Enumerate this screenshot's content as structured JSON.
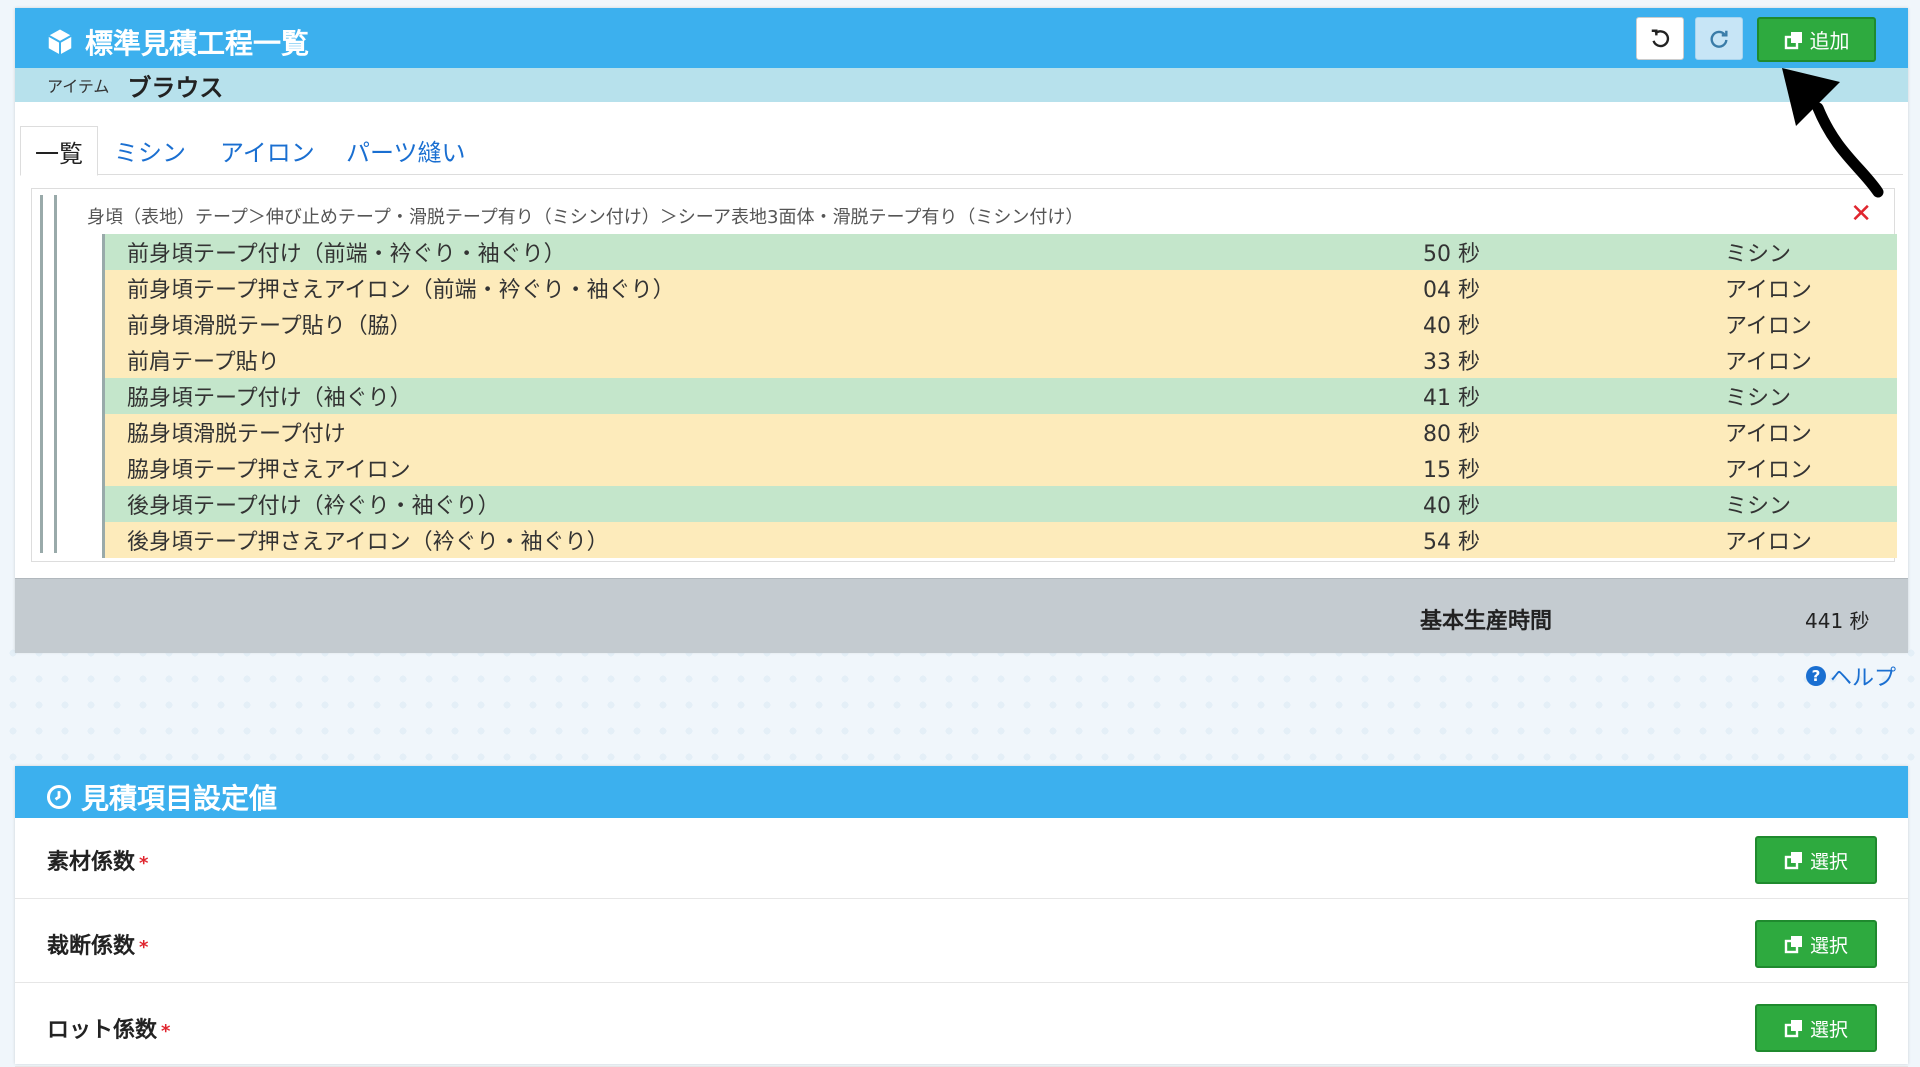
{
  "panel1": {
    "title": "標準見積工程一覧",
    "add_label": "追加",
    "item_label": "アイテム",
    "item_value": "ブラウス",
    "tabs": [
      "一覧",
      "ミシン",
      "アイロン",
      "パーツ縫い"
    ],
    "breadcrumb": "身頃（表地）テープ＞伸び止めテープ・滑脱テープ有り（ミシン付け）＞シーア表地3面体・滑脱テープ有り（ミシン付け）",
    "rows": [
      {
        "name": "前身頃テープ付け（前端・衿ぐり・袖ぐり）",
        "time": "50 秒",
        "process": "ミシン"
      },
      {
        "name": "前身頃テープ押さえアイロン（前端・衿ぐり・袖ぐり）",
        "time": "04 秒",
        "process": "アイロン"
      },
      {
        "name": "前身頃滑脱テープ貼り（脇）",
        "time": "40 秒",
        "process": "アイロン"
      },
      {
        "name": "前肩テープ貼り",
        "time": "33 秒",
        "process": "アイロン"
      },
      {
        "name": "脇身頃テープ付け（袖ぐり）",
        "time": "41 秒",
        "process": "ミシン"
      },
      {
        "name": "脇身頃滑脱テープ付け",
        "time": "80 秒",
        "process": "アイロン"
      },
      {
        "name": "脇身頃テープ押さえアイロン",
        "time": "15 秒",
        "process": "アイロン"
      },
      {
        "name": "後身頃テープ付け（衿ぐり・袖ぐり）",
        "time": "40 秒",
        "process": "ミシン"
      },
      {
        "name": "後身頃テープ押さえアイロン（衿ぐり・袖ぐり）",
        "time": "54 秒",
        "process": "アイロン"
      }
    ],
    "total_label": "基本生産時間",
    "total_value": "441 秒",
    "help_label": "ヘルプ"
  },
  "panel2": {
    "title": "見積項目設定値",
    "select_label": "選択",
    "fields": [
      {
        "label": "素材係数"
      },
      {
        "label": "裁断係数"
      },
      {
        "label": "ロット係数"
      }
    ]
  },
  "colors": {
    "header_blue": "#3cb0ee",
    "row_green": "#c4e6cb",
    "row_yellow": "#fdebbb",
    "button_green": "#2eaa3f",
    "close_red": "#e0262f"
  }
}
